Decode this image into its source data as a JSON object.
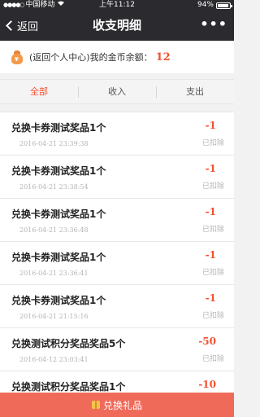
{
  "status_bar": {
    "carrier": "中国移动",
    "time": "上午11:12",
    "battery": "94%"
  },
  "nav": {
    "back_label": "返回",
    "title": "收支明细",
    "more_label": "•••"
  },
  "balance": {
    "label": "(返回个人中心)我的金币余额：",
    "amount": "12"
  },
  "tabs": [
    {
      "label": "全部",
      "active": true
    },
    {
      "label": "收入",
      "active": false
    },
    {
      "label": "支出",
      "active": false
    }
  ],
  "records": [
    {
      "title": "兑换卡券测试奖品1个",
      "date": "2016-04-21 23:39:38",
      "amount": "-1",
      "status": "已扣除"
    },
    {
      "title": "兑换卡券测试奖品1个",
      "date": "2016-04-21 23:38:54",
      "amount": "-1",
      "status": "已扣除"
    },
    {
      "title": "兑换卡券测试奖品1个",
      "date": "2016-04-21 23:36:48",
      "amount": "-1",
      "status": "已扣除"
    },
    {
      "title": "兑换卡券测试奖品1个",
      "date": "2016-04-21 23:36:41",
      "amount": "-1",
      "status": "已扣除"
    },
    {
      "title": "兑换卡券测试奖品1个",
      "date": "2016-04-21 21:15:16",
      "amount": "-1",
      "status": "已扣除"
    },
    {
      "title": "兑换测试积分奖品奖品5个",
      "date": "2016-04-12 23:03:41",
      "amount": "-50",
      "status": "已扣除"
    },
    {
      "title": "兑换测试积分奖品奖品1个",
      "date": "",
      "amount": "-10",
      "status": ""
    }
  ],
  "footer": {
    "label": "兑换礼品"
  },
  "colors": {
    "accent": "#f2512f",
    "nav_bg": "#2b2b2f",
    "footer_bg": "#f06a5a"
  },
  "icons": {
    "balance": "money-bag-icon",
    "footer": "gift-icon",
    "back": "chevron-left-icon",
    "wifi": "wifi-icon",
    "battery": "battery-icon"
  }
}
